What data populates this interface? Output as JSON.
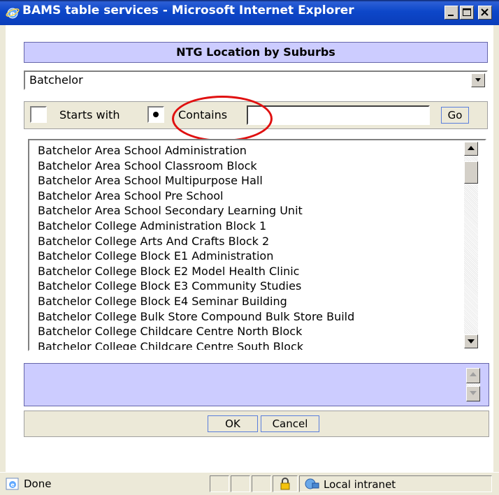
{
  "window": {
    "title": "BAMS table services - Microsoft Internet Explorer"
  },
  "panel": {
    "header": "NTG Location by Suburbs"
  },
  "suburb_select": {
    "value": "Batchelor"
  },
  "search": {
    "starts_with_label": "Starts with",
    "contains_label": "Contains",
    "selected_mode": "contains",
    "query_value": "",
    "go_label": "Go"
  },
  "results": {
    "items": [
      "Batchelor Area School Administration",
      "Batchelor Area School Classroom Block",
      "Batchelor Area School Multipurpose Hall",
      "Batchelor Area School Pre School",
      "Batchelor Area School Secondary Learning Unit",
      "Batchelor College Administration Block 1",
      "Batchelor College Arts And Crafts Block 2",
      "Batchelor College Block E1 Administration",
      "Batchelor College Block E2 Model Health Clinic",
      "Batchelor College Block E3 Community Studies",
      "Batchelor College Block E4 Seminar Building",
      "Batchelor College Bulk Store Compound Bulk Store Build",
      "Batchelor College Childcare Centre North Block",
      "Batchelor College Childcare Centre South Block"
    ]
  },
  "actions": {
    "ok_label": "OK",
    "cancel_label": "Cancel"
  },
  "statusbar": {
    "status_text": "Done",
    "zone_text": "Local intranet"
  },
  "colors": {
    "panel_accent": "#ccccff",
    "annotation": "#e01010",
    "titlebar": "#0a3dba"
  }
}
